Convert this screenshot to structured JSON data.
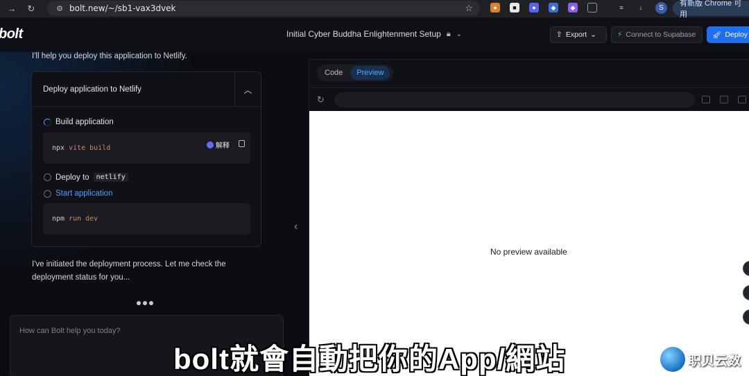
{
  "browser": {
    "url": "bolt.new/~/sb1-vax3dvek",
    "avatar_letter": "S",
    "update_label": "有新版 Chrome 可用"
  },
  "header": {
    "logo": "bolt",
    "project_title": "Initial Cyber Buddha Enlightenment Setup",
    "export_label": "Export",
    "supabase_label": "Connect to Supabase",
    "deploy_label": "Deploy"
  },
  "chat": {
    "intro": "I'll help you deploy this application to Netlify.",
    "card": {
      "title": "Deploy application to Netlify",
      "steps": [
        {
          "label": "Build application",
          "state": "running"
        },
        {
          "label": "Deploy to",
          "tag": "netlify",
          "state": "pending"
        },
        {
          "label": "Start application",
          "state": "pending"
        }
      ],
      "build_cmd": "npx",
      "build_args": "vite build",
      "explain_label": "解释",
      "start_cmd": "npm",
      "start_args": "run dev"
    },
    "followup": "I've initiated the deployment process. Let me check the deployment status for you...",
    "prompt_placeholder": "How can Bolt help you today?"
  },
  "workbench": {
    "tabs": [
      "Code",
      "Preview"
    ],
    "active_tab": "Preview",
    "empty_message": "No preview available"
  },
  "overlay": {
    "subtitle": "bolt就會自動把你的App/網站",
    "watermark": "职贝云数"
  }
}
